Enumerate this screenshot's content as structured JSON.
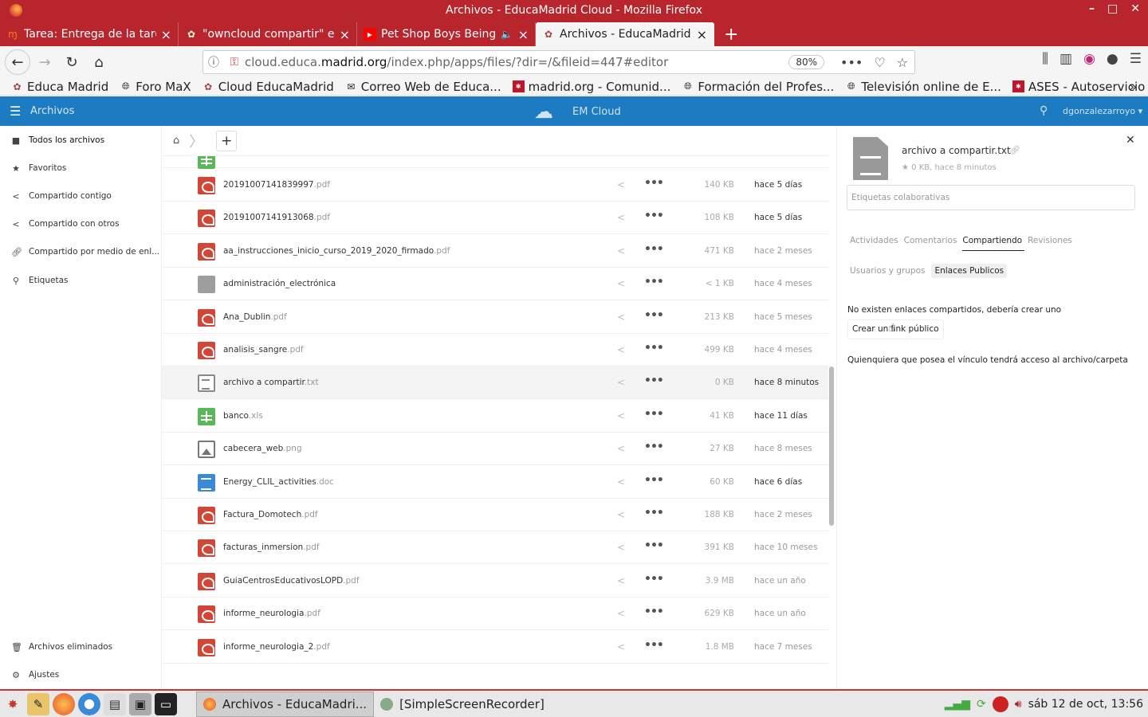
{
  "window": {
    "title": "Archivos - EducaMadrid Cloud - Mozilla Firefox",
    "controls": [
      "–",
      "□",
      "✕"
    ]
  },
  "tabs": [
    {
      "label": "Tarea: Entrega de la tarea",
      "icon": "moodle-icon",
      "active": false
    },
    {
      "label": "\"owncloud compartir\" en",
      "icon": "educamadrid-icon",
      "active": false
    },
    {
      "label": "Pet Shop Boys Being Bo",
      "icon": "youtube-icon",
      "active": false
    },
    {
      "label": "Archivos - EducaMadrid C",
      "icon": "educamadrid-icon",
      "active": true
    }
  ],
  "url": {
    "prefix": "cloud.educa.",
    "domain": "madrid.org",
    "path": "/index.php/apps/files/?dir=/&fileid=447#editor",
    "zoom": "80%"
  },
  "bookmarks": [
    {
      "label": "Educa Madrid",
      "icon": "educamadrid-icon"
    },
    {
      "label": "Foro MaX",
      "icon": "globe-icon"
    },
    {
      "label": "Cloud EducaMadrid",
      "icon": "educamadrid-icon"
    },
    {
      "label": "Correo Web de Educa...",
      "icon": "mail-icon"
    },
    {
      "label": "madrid.org - Comunid...",
      "icon": "madrid-icon"
    },
    {
      "label": "Formación del Profes...",
      "icon": "globe-icon"
    },
    {
      "label": "Televisión online de E...",
      "icon": "globe-icon"
    },
    {
      "label": "ASES - Autoservicio d...",
      "icon": "madrid-icon"
    }
  ],
  "app": {
    "name": "Archivos",
    "logo_text": "EM Cloud",
    "user": "dgonzalezarroyo"
  },
  "sidebar": {
    "items": [
      {
        "label": "Todos los archivos",
        "icon": "folder-icon"
      },
      {
        "label": "Favoritos",
        "icon": "star-icon"
      },
      {
        "label": "Compartido contigo",
        "icon": "share-icon"
      },
      {
        "label": "Compartido con otros",
        "icon": "share-icon"
      },
      {
        "label": "Compartido por medio de enl...",
        "icon": "link-icon"
      },
      {
        "label": "Etiquetas",
        "icon": "search-icon"
      }
    ],
    "bottom": [
      {
        "label": "Archivos eliminados",
        "icon": "trash-icon"
      },
      {
        "label": "Ajustes",
        "icon": "gear-icon"
      }
    ]
  },
  "files": [
    {
      "name": "20191007141839997",
      "ext": ".pdf",
      "type": "pdf",
      "size": "140 KB",
      "date": "hace 5 días"
    },
    {
      "name": "20191007141913068",
      "ext": ".pdf",
      "type": "pdf",
      "size": "108 KB",
      "date": "hace 5 días"
    },
    {
      "name": "aa_instrucciones_inicio_curso_2019_2020_firmado",
      "ext": ".pdf",
      "type": "pdf",
      "size": "471 KB",
      "date": "hace 2 meses"
    },
    {
      "name": "administración_electrónica",
      "ext": "",
      "type": "folder",
      "size": "< 1 KB",
      "date": "hace 4 meses"
    },
    {
      "name": "Ana_Dublin",
      "ext": ".pdf",
      "type": "pdf",
      "size": "213 KB",
      "date": "hace 5 meses"
    },
    {
      "name": "analisis_sangre",
      "ext": ".pdf",
      "type": "pdf",
      "size": "499 KB",
      "date": "hace 4 meses"
    },
    {
      "name": "archivo a compartir",
      "ext": ".txt",
      "type": "txt",
      "size": "0 KB",
      "date": "hace 8 minutos"
    },
    {
      "name": "banco",
      "ext": ".xls",
      "type": "xls",
      "size": "41 KB",
      "date": "hace 11 días"
    },
    {
      "name": "cabecera_web",
      "ext": ".png",
      "type": "img",
      "size": "27 KB",
      "date": "hace 8 meses"
    },
    {
      "name": "Energy_CLIL_activities",
      "ext": ".doc",
      "type": "doc",
      "size": "60 KB",
      "date": "hace 6 días"
    },
    {
      "name": "Factura_Domotech",
      "ext": ".pdf",
      "type": "pdf",
      "size": "188 KB",
      "date": "hace 2 meses"
    },
    {
      "name": "facturas_inmersion",
      "ext": ".pdf",
      "type": "pdf",
      "size": "391 KB",
      "date": "hace 10 meses"
    },
    {
      "name": "GuiaCentrosEducativosLOPD",
      "ext": ".pdf",
      "type": "pdf",
      "size": "3.9 MB",
      "date": "hace un año"
    },
    {
      "name": "informe_neurologia",
      "ext": ".pdf",
      "type": "pdf",
      "size": "629 KB",
      "date": "hace un año"
    },
    {
      "name": "informe_neurologia_2",
      "ext": ".pdf",
      "type": "pdf",
      "size": "1.8 MB",
      "date": "hace 7 meses"
    }
  ],
  "selected_file": "archivo a compartir",
  "panel": {
    "filename": "archivo a compartir.txt",
    "meta": "0 KB, hace 8 minutos",
    "tags_placeholder": "Etiquetas colaborativas",
    "tabs": [
      "Actividades",
      "Comentarios",
      "Compartiendo",
      "Revisiones"
    ],
    "active_tab": "Compartiendo",
    "subtabs": [
      "Usuarios y grupos",
      "Enlaces Publicos"
    ],
    "active_subtab": "Enlaces Publicos",
    "no_links_text": "No existen enlaces compartidos, debería crear uno",
    "create_link_button": "Crear un link público",
    "access_text": "Quienquiera que posea el vínculo tendrá acceso al archivo/carpeta"
  },
  "taskbar": {
    "tasks": [
      {
        "label": "Archivos - EducaMadri...",
        "active": true
      },
      {
        "label": "[SimpleScreenRecorder]",
        "active": false
      }
    ],
    "clock": "sáb 12 de oct, 13:56"
  },
  "colors": {
    "browser_red": "#b8252d",
    "app_blue": "#1d7bc2",
    "pdf_red": "#d24637"
  }
}
